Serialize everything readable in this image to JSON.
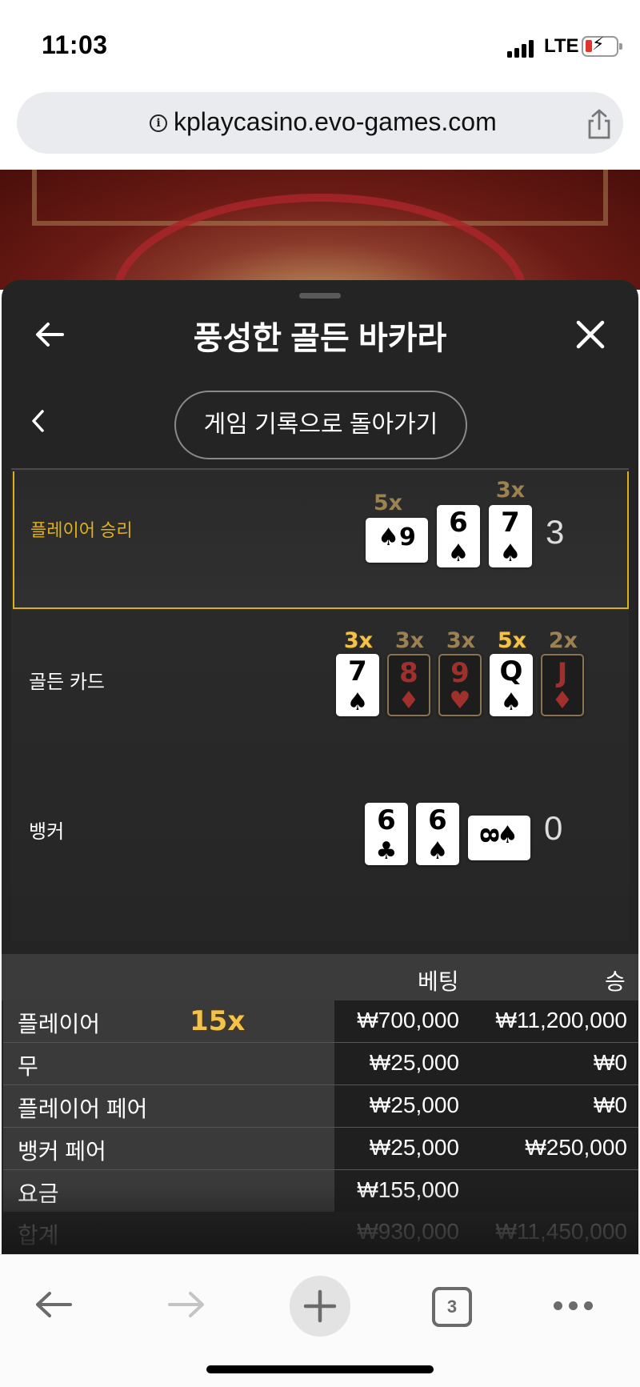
{
  "status_bar": {
    "time": "11:03",
    "network": "LTE"
  },
  "browser": {
    "url": "kplaycasino.evo-games.com",
    "info_glyph": "i",
    "tab_count": "3"
  },
  "panel": {
    "title": "풍성한 골든 바카라",
    "history_button": "게임 기록으로 돌아가기"
  },
  "results": {
    "player": {
      "label": "플레이어 승리",
      "score": "3",
      "cards": [
        {
          "rank": "9",
          "suit": "♠",
          "orientation": "sideways",
          "multiplier": "5x"
        },
        {
          "rank": "6",
          "suit": "♠",
          "multiplier": ""
        },
        {
          "rank": "7",
          "suit": "♠",
          "multiplier": "3x"
        }
      ]
    },
    "golden": {
      "label": "골든 카드",
      "cards": [
        {
          "rank": "7",
          "suit": "♠",
          "multiplier": "3x",
          "active": true
        },
        {
          "rank": "8",
          "suit": "♦",
          "multiplier": "3x",
          "active": false
        },
        {
          "rank": "9",
          "suit": "♥",
          "multiplier": "3x",
          "active": false
        },
        {
          "rank": "Q",
          "suit": "♠",
          "multiplier": "5x",
          "active": true
        },
        {
          "rank": "J",
          "suit": "♦",
          "multiplier": "2x",
          "active": false
        }
      ]
    },
    "banker": {
      "label": "뱅커",
      "score": "0",
      "cards": [
        {
          "rank": "6",
          "suit": "♣"
        },
        {
          "rank": "6",
          "suit": "♠"
        },
        {
          "rank": "8",
          "suit": "♠",
          "orientation": "sideways"
        }
      ]
    }
  },
  "bet_table": {
    "headers": {
      "bet": "베팅",
      "win": "승"
    },
    "player_multiplier": "15x",
    "rows": [
      {
        "name": "플레이어",
        "bet": "₩700,000",
        "win": "₩11,200,000"
      },
      {
        "name": "무",
        "bet": "₩25,000",
        "win": "₩0"
      },
      {
        "name": "플레이어 페어",
        "bet": "₩25,000",
        "win": "₩0"
      },
      {
        "name": "뱅커 페어",
        "bet": "₩25,000",
        "win": "₩250,000"
      },
      {
        "name": "요금",
        "bet": "₩155,000",
        "win": ""
      },
      {
        "name": "합계",
        "bet": "₩930,000",
        "win": "₩11,450,000"
      }
    ]
  },
  "colors": {
    "gold": "#e0b11a",
    "panel_bg": "#242424",
    "red_suit": "#a0302c"
  },
  "icons": [
    "signal-icon",
    "battery-icon",
    "info-icon",
    "share-icon",
    "back-arrow-icon",
    "close-icon",
    "chevron-left-icon",
    "nav-back-icon",
    "nav-forward-icon",
    "new-tab-icon",
    "tabs-icon",
    "more-icon"
  ]
}
